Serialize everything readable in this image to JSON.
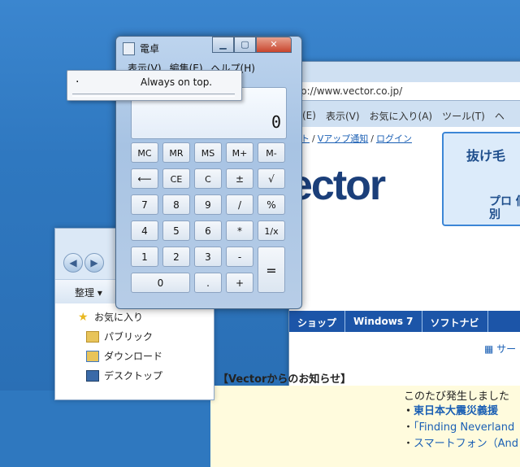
{
  "browser": {
    "address": "p://www.vector.co.jp/",
    "menu": [
      "(E)",
      "表示(V)",
      "お気に入り(A)",
      "ツール(T)",
      "ヘ"
    ],
    "links": [
      "ト",
      "Vアップ通知",
      "ログイン"
    ],
    "logo": "ector",
    "ad_line1": "抜け毛",
    "ad_line2": "プロ 個別",
    "nav": [
      "ショップ",
      "Windows 7",
      "ソフトナビ"
    ],
    "tool_link": "サー",
    "notice_intro": "このたび発生しました",
    "notice_items": [
      "東日本大震災義援",
      "「Finding Neverland",
      "スマートフォン（And"
    ],
    "notice_head": "【Vectorからのお知らせ】"
  },
  "explorer": {
    "organize": "整理 ▾",
    "items": [
      "お気に入り",
      "パブリック",
      "ダウンロード",
      "デスクトップ"
    ]
  },
  "calculator": {
    "title": "電卓",
    "menu": [
      "表示(V)",
      "編集(E)",
      "ヘルプ(H)"
    ],
    "display": "0",
    "keys": {
      "mc": "MC",
      "mr": "MR",
      "ms": "MS",
      "mplus": "M+",
      "mminus": "M-",
      "back": "⟵",
      "ce": "CE",
      "c": "C",
      "pm": "±",
      "sqrt": "√",
      "k7": "7",
      "k8": "8",
      "k9": "9",
      "div": "/",
      "pct": "%",
      "k4": "4",
      "k5": "5",
      "k6": "6",
      "mul": "*",
      "inv": "1/x",
      "k1": "1",
      "k2": "2",
      "k3": "3",
      "sub": "-",
      "eq": "=",
      "k0": "0",
      "dot": ".",
      "add": "+"
    },
    "caption": {
      "min": "▁",
      "max": "▢",
      "close": "✕"
    }
  },
  "popup": {
    "label": "Always on top.",
    "bullet": "·"
  }
}
